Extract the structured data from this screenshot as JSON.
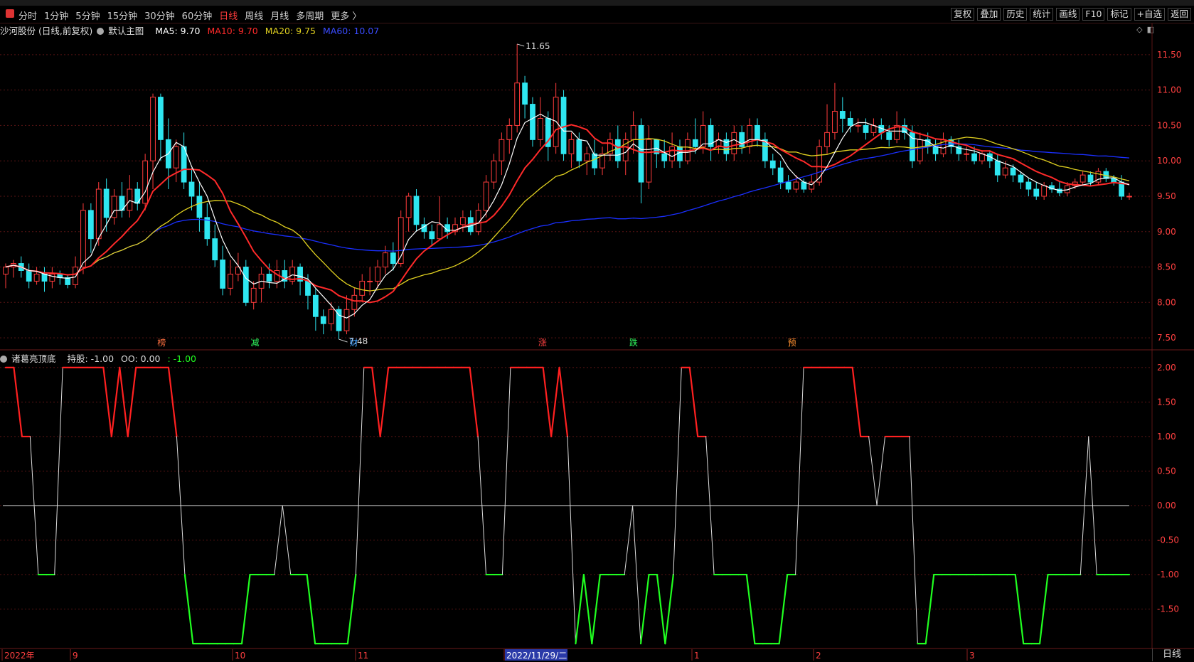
{
  "toolbar": {
    "periods": [
      "分时",
      "1分钟",
      "5分钟",
      "15分钟",
      "30分钟",
      "60分钟",
      "日线",
      "周线",
      "月线",
      "多周期",
      "更多 〉"
    ],
    "active_period": "日线",
    "tools": [
      "复权",
      "叠加",
      "历史",
      "统计",
      "画线",
      "F10",
      "标记",
      "+自选",
      "返回"
    ]
  },
  "main_chart": {
    "stock_label": "沙河股份 (日线,前复权)",
    "template_label": "默认主图",
    "ma5_label": "MA5: 9.70",
    "ma10_label": "MA10: 9.70",
    "ma20_label": "MA20: 9.75",
    "ma60_label": "MA60: 10.07",
    "high_annotation": "11.65",
    "low_annotation": "7.48",
    "event_markers": [
      "榜",
      "减",
      "财",
      "涨",
      "跌",
      "预"
    ],
    "icons": [
      "diamond-icon",
      "square-icon"
    ]
  },
  "indicator": {
    "name_label": "诸葛亮顶底",
    "hold_label": "持股: -1.00",
    "oo_label": "OO: 0.00",
    "last_label": ": -1.00"
  },
  "bottom_tab": "日线",
  "colors": {
    "up": "#ff3b3b",
    "down": "#2ee6f0",
    "ma5": "#ffffff",
    "ma10": "#ff2a2a",
    "ma20": "#e0d020",
    "ma60": "#1a2fff",
    "signal_top": "#ff2020",
    "signal_bottom": "#20ff20",
    "signal_mid": "#dddddd",
    "grid": "#5a1414"
  },
  "chart_data": [
    {
      "type": "candlestick",
      "title": "沙河股份 (日线,前复权)",
      "y_ticks": [
        11.5,
        11.0,
        10.5,
        10.0,
        9.5,
        9.0,
        8.5,
        8.0,
        7.5
      ],
      "ylim": [
        7.35,
        11.75
      ],
      "x_ticks": [
        "2022年",
        "9",
        "10",
        "11",
        "2022/11/29/二",
        "1",
        "2",
        "3"
      ],
      "series_ma": [
        {
          "name": "MA5",
          "last": 9.7
        },
        {
          "name": "MA10",
          "last": 9.7
        },
        {
          "name": "MA20",
          "last": 9.75
        },
        {
          "name": "MA60",
          "last": 10.07
        }
      ],
      "candles": [
        [
          8.4,
          8.5,
          8.2,
          8.55
        ],
        [
          8.5,
          8.55,
          8.35,
          8.6
        ],
        [
          8.55,
          8.45,
          8.35,
          8.65
        ],
        [
          8.45,
          8.3,
          8.2,
          8.55
        ],
        [
          8.3,
          8.4,
          8.25,
          8.5
        ],
        [
          8.4,
          8.3,
          8.15,
          8.5
        ],
        [
          8.3,
          8.4,
          8.2,
          8.5
        ],
        [
          8.4,
          8.35,
          8.25,
          8.45
        ],
        [
          8.35,
          8.25,
          8.2,
          8.4
        ],
        [
          8.25,
          8.5,
          8.2,
          8.65
        ],
        [
          8.5,
          9.3,
          8.4,
          9.4
        ],
        [
          9.3,
          8.9,
          8.7,
          9.4
        ],
        [
          8.9,
          9.6,
          8.8,
          9.7
        ],
        [
          9.6,
          9.2,
          9.0,
          9.75
        ],
        [
          9.2,
          9.5,
          9.1,
          9.6
        ],
        [
          9.5,
          9.3,
          9.2,
          9.7
        ],
        [
          9.3,
          9.6,
          9.2,
          9.8
        ],
        [
          9.6,
          9.4,
          9.3,
          9.7
        ],
        [
          9.4,
          10.0,
          9.3,
          10.1
        ],
        [
          10.0,
          10.9,
          9.6,
          10.95
        ],
        [
          10.9,
          10.3,
          10.0,
          10.95
        ],
        [
          10.3,
          9.9,
          9.6,
          10.6
        ],
        [
          9.9,
          10.2,
          9.7,
          10.3
        ],
        [
          10.2,
          9.7,
          9.6,
          10.4
        ],
        [
          9.7,
          9.5,
          9.3,
          9.9
        ],
        [
          9.5,
          9.2,
          9.0,
          9.7
        ],
        [
          9.2,
          8.9,
          8.8,
          9.4
        ],
        [
          8.9,
          8.6,
          8.5,
          9.1
        ],
        [
          8.6,
          8.2,
          8.1,
          8.8
        ],
        [
          8.2,
          8.4,
          8.1,
          8.6
        ],
        [
          8.4,
          8.5,
          8.3,
          8.7
        ],
        [
          8.5,
          8.0,
          7.95,
          8.6
        ],
        [
          8.0,
          8.2,
          7.9,
          8.3
        ],
        [
          8.2,
          8.4,
          8.0,
          8.5
        ],
        [
          8.4,
          8.3,
          8.2,
          8.55
        ],
        [
          8.3,
          8.45,
          8.2,
          8.6
        ],
        [
          8.45,
          8.3,
          8.2,
          8.6
        ],
        [
          8.3,
          8.5,
          8.25,
          8.6
        ],
        [
          8.5,
          8.3,
          8.1,
          8.55
        ],
        [
          8.3,
          8.1,
          7.9,
          8.4
        ],
        [
          8.1,
          7.8,
          7.6,
          8.2
        ],
        [
          7.8,
          7.7,
          7.55,
          7.9
        ],
        [
          7.7,
          7.9,
          7.6,
          8.0
        ],
        [
          7.9,
          7.6,
          7.48,
          7.95
        ],
        [
          7.6,
          7.9,
          7.55,
          8.1
        ],
        [
          7.9,
          8.1,
          7.8,
          8.2
        ],
        [
          8.1,
          8.3,
          8.0,
          8.4
        ],
        [
          8.3,
          8.3,
          8.1,
          8.5
        ],
        [
          8.3,
          8.5,
          8.2,
          8.6
        ],
        [
          8.5,
          8.7,
          8.4,
          8.8
        ],
        [
          8.7,
          8.55,
          8.45,
          8.85
        ],
        [
          8.55,
          9.2,
          8.5,
          9.3
        ],
        [
          9.2,
          9.5,
          9.0,
          9.55
        ],
        [
          9.5,
          9.1,
          9.0,
          9.6
        ],
        [
          9.1,
          9.0,
          8.9,
          9.2
        ],
        [
          9.0,
          8.9,
          8.8,
          9.1
        ],
        [
          8.9,
          9.1,
          8.9,
          9.5
        ],
        [
          9.1,
          9.0,
          8.9,
          9.2
        ],
        [
          9.0,
          9.1,
          8.95,
          9.2
        ],
        [
          9.1,
          9.2,
          9.0,
          9.3
        ],
        [
          9.2,
          9.0,
          8.95,
          9.3
        ],
        [
          9.0,
          9.3,
          8.95,
          9.4
        ],
        [
          9.3,
          9.7,
          9.2,
          9.8
        ],
        [
          9.7,
          10.0,
          9.6,
          10.1
        ],
        [
          10.0,
          10.3,
          9.8,
          10.4
        ],
        [
          10.3,
          10.5,
          10.1,
          10.6
        ],
        [
          10.5,
          11.1,
          10.4,
          11.65
        ],
        [
          11.1,
          10.8,
          10.6,
          11.2
        ],
        [
          10.8,
          10.3,
          10.2,
          10.9
        ],
        [
          10.3,
          10.6,
          10.2,
          10.9
        ],
        [
          10.6,
          10.2,
          10.0,
          10.7
        ],
        [
          10.2,
          10.9,
          10.1,
          11.1
        ],
        [
          10.9,
          10.1,
          10.0,
          11.0
        ],
        [
          10.1,
          10.3,
          9.9,
          10.4
        ],
        [
          10.3,
          10.0,
          9.9,
          10.4
        ],
        [
          10.0,
          10.1,
          9.8,
          10.2
        ],
        [
          10.1,
          9.9,
          9.8,
          10.3
        ],
        [
          9.9,
          10.1,
          9.8,
          10.2
        ],
        [
          10.1,
          10.3,
          10.0,
          10.4
        ],
        [
          10.3,
          10.0,
          9.9,
          10.5
        ],
        [
          10.0,
          10.3,
          9.8,
          10.4
        ],
        [
          10.3,
          10.5,
          10.1,
          10.7
        ],
        [
          10.5,
          9.7,
          9.4,
          10.6
        ],
        [
          9.7,
          10.3,
          9.6,
          10.5
        ],
        [
          10.3,
          10.1,
          9.9,
          10.3
        ],
        [
          10.1,
          10.0,
          9.9,
          10.3
        ],
        [
          10.0,
          10.2,
          9.9,
          10.4
        ],
        [
          10.2,
          10.0,
          9.9,
          10.3
        ],
        [
          10.0,
          10.3,
          9.95,
          10.4
        ],
        [
          10.3,
          10.2,
          10.1,
          10.6
        ],
        [
          10.2,
          10.5,
          10.1,
          10.7
        ],
        [
          10.5,
          10.2,
          10.0,
          10.6
        ],
        [
          10.2,
          10.3,
          10.1,
          10.4
        ],
        [
          10.3,
          10.1,
          10.0,
          10.4
        ],
        [
          10.1,
          10.4,
          10.0,
          10.5
        ],
        [
          10.4,
          10.2,
          10.1,
          10.5
        ],
        [
          10.2,
          10.5,
          10.1,
          10.6
        ],
        [
          10.5,
          10.3,
          10.2,
          10.6
        ],
        [
          10.3,
          10.0,
          9.9,
          10.4
        ],
        [
          10.0,
          9.9,
          9.8,
          10.1
        ],
        [
          9.9,
          9.7,
          9.6,
          10.0
        ],
        [
          9.7,
          9.6,
          9.55,
          9.8
        ],
        [
          9.6,
          9.7,
          9.55,
          9.8
        ],
        [
          9.7,
          9.6,
          9.55,
          9.75
        ],
        [
          9.6,
          9.7,
          9.55,
          9.8
        ],
        [
          9.7,
          10.2,
          9.65,
          10.3
        ],
        [
          10.2,
          10.4,
          10.1,
          10.8
        ],
        [
          10.4,
          10.7,
          10.3,
          11.1
        ],
        [
          10.7,
          10.6,
          10.4,
          10.9
        ],
        [
          10.6,
          10.5,
          10.4,
          10.7
        ],
        [
          10.5,
          10.5,
          10.4,
          10.6
        ],
        [
          10.5,
          10.4,
          10.3,
          10.6
        ],
        [
          10.4,
          10.5,
          10.35,
          10.6
        ],
        [
          10.5,
          10.4,
          10.3,
          10.6
        ],
        [
          10.4,
          10.3,
          10.2,
          10.5
        ],
        [
          10.3,
          10.5,
          10.25,
          10.7
        ],
        [
          10.5,
          10.4,
          10.3,
          10.6
        ],
        [
          10.4,
          10.0,
          9.9,
          10.5
        ],
        [
          10.0,
          10.3,
          9.95,
          10.4
        ],
        [
          10.3,
          10.2,
          10.1,
          10.4
        ],
        [
          10.2,
          10.1,
          10.0,
          10.3
        ],
        [
          10.1,
          10.3,
          10.05,
          10.4
        ],
        [
          10.3,
          10.2,
          10.1,
          10.35
        ],
        [
          10.2,
          10.1,
          10.0,
          10.3
        ],
        [
          10.1,
          10.1,
          10.0,
          10.2
        ],
        [
          10.1,
          10.0,
          9.95,
          10.2
        ],
        [
          10.0,
          10.1,
          9.95,
          10.15
        ],
        [
          10.1,
          10.0,
          9.9,
          10.15
        ],
        [
          10.0,
          9.8,
          9.7,
          10.1
        ],
        [
          9.8,
          9.9,
          9.75,
          10.0
        ],
        [
          9.9,
          9.8,
          9.7,
          9.95
        ],
        [
          9.8,
          9.7,
          9.6,
          9.85
        ],
        [
          9.7,
          9.6,
          9.5,
          9.75
        ],
        [
          9.6,
          9.5,
          9.45,
          9.7
        ],
        [
          9.5,
          9.65,
          9.45,
          9.7
        ],
        [
          9.65,
          9.6,
          9.55,
          9.7
        ],
        [
          9.6,
          9.55,
          9.5,
          9.7
        ],
        [
          9.55,
          9.65,
          9.5,
          9.7
        ],
        [
          9.65,
          9.7,
          9.6,
          9.75
        ],
        [
          9.7,
          9.8,
          9.65,
          9.85
        ],
        [
          9.8,
          9.7,
          9.65,
          9.85
        ],
        [
          9.7,
          9.85,
          9.65,
          9.9
        ],
        [
          9.85,
          9.75,
          9.7,
          9.9
        ],
        [
          9.75,
          9.7,
          9.65,
          9.8
        ],
        [
          9.7,
          9.5,
          9.45,
          9.8
        ],
        [
          9.5,
          9.5,
          9.45,
          9.55
        ]
      ]
    },
    {
      "type": "line",
      "title": "诸葛亮顶底",
      "y_ticks": [
        2.0,
        1.5,
        1.0,
        0.5,
        0.0,
        -0.5,
        -1.0,
        -1.5
      ],
      "ylim": [
        -2.05,
        2.05
      ],
      "series": [
        {
          "name": "诸葛亮顶底",
          "values": [
            2,
            2,
            1,
            1,
            -1,
            -1,
            -1,
            2,
            2,
            2,
            2,
            2,
            2,
            1,
            2,
            1,
            2,
            2,
            2,
            2,
            2,
            1,
            -1,
            -2,
            -2,
            -2,
            -2,
            -2,
            -2,
            -2,
            -1,
            -1,
            -1,
            -1,
            0,
            -1,
            -1,
            -1,
            -2,
            -2,
            -2,
            -2,
            -2,
            -1,
            2,
            2,
            1,
            2,
            2,
            2,
            2,
            2,
            2,
            2,
            2,
            2,
            2,
            2,
            1,
            -1,
            -1,
            -1,
            2,
            2,
            2,
            2,
            2,
            1,
            2,
            1,
            -2,
            -1,
            -2,
            -1,
            -1,
            -1,
            -1,
            0,
            -2,
            -1,
            -1,
            -2,
            -1,
            2,
            2,
            1,
            1,
            -1,
            -1,
            -1,
            -1,
            -1,
            -2,
            -2,
            -2,
            -2,
            -1,
            -1,
            2,
            2,
            2,
            2,
            2,
            2,
            2,
            1,
            1,
            0,
            1,
            1,
            1,
            1,
            -2,
            -2,
            -1,
            -1,
            -1,
            -1,
            -1,
            -1,
            -1,
            -1,
            -1,
            -1,
            -1,
            -2,
            -2,
            -2,
            -1,
            -1,
            -1,
            -1,
            -1,
            1,
            -1,
            -1,
            -1,
            -1,
            -1
          ]
        }
      ]
    }
  ]
}
